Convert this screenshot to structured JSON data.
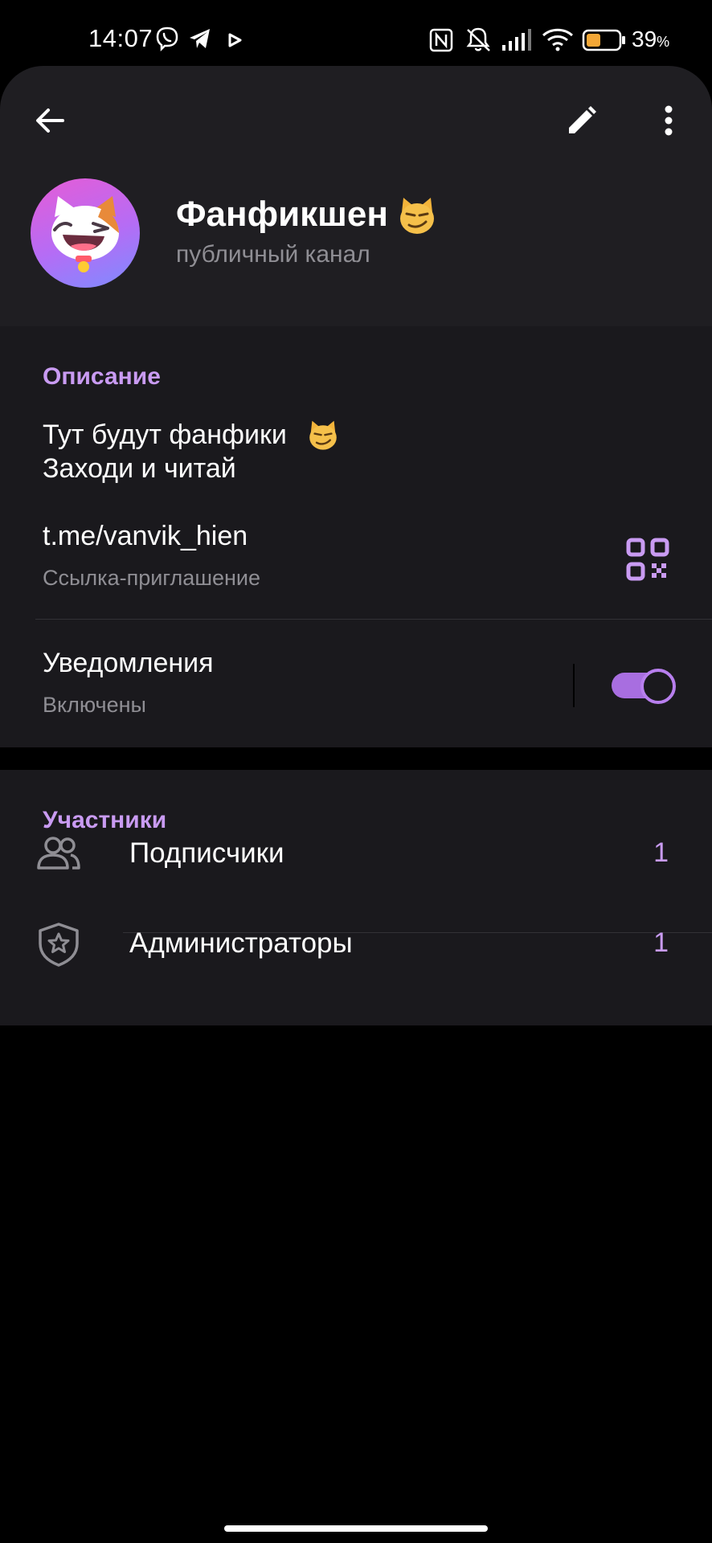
{
  "status_bar": {
    "time": "14:07",
    "battery_percent": "39",
    "battery_unit": "%",
    "icons": [
      "viber-icon",
      "telegram-icon",
      "play-icon",
      "nfc-icon",
      "mute-icon",
      "signal-icon",
      "wifi-icon",
      "battery-icon"
    ]
  },
  "header": {
    "back_icon": "arrow-left-icon",
    "edit_icon": "pencil-icon",
    "menu_icon": "more-vertical-icon",
    "channel_name": "Фанфикшен",
    "title_emoji": "smirking-cat-emoji",
    "channel_type": "публичный канал"
  },
  "info": {
    "description_title": "Описание",
    "description_lines": [
      "Тут будут фанфики",
      "Заходи и читай"
    ],
    "link": "t.me/vanvik_hien",
    "link_caption": "Ссылка-приглашение",
    "notifications_title": "Уведомления",
    "notifications_state": "Включены",
    "notifications_on": true
  },
  "members": {
    "section_title": "Участники",
    "rows": [
      {
        "label": "Подписчики",
        "count": "1",
        "icon": "users-icon"
      },
      {
        "label": "Администраторы",
        "count": "1",
        "icon": "shield-star-icon"
      }
    ]
  },
  "colors": {
    "accent": "#c99bf2",
    "header_bg": "#1f1e22",
    "section_bg": "#1a191d",
    "toggle_track": "#a86ee0",
    "secondary_text": "#8f8e94"
  }
}
